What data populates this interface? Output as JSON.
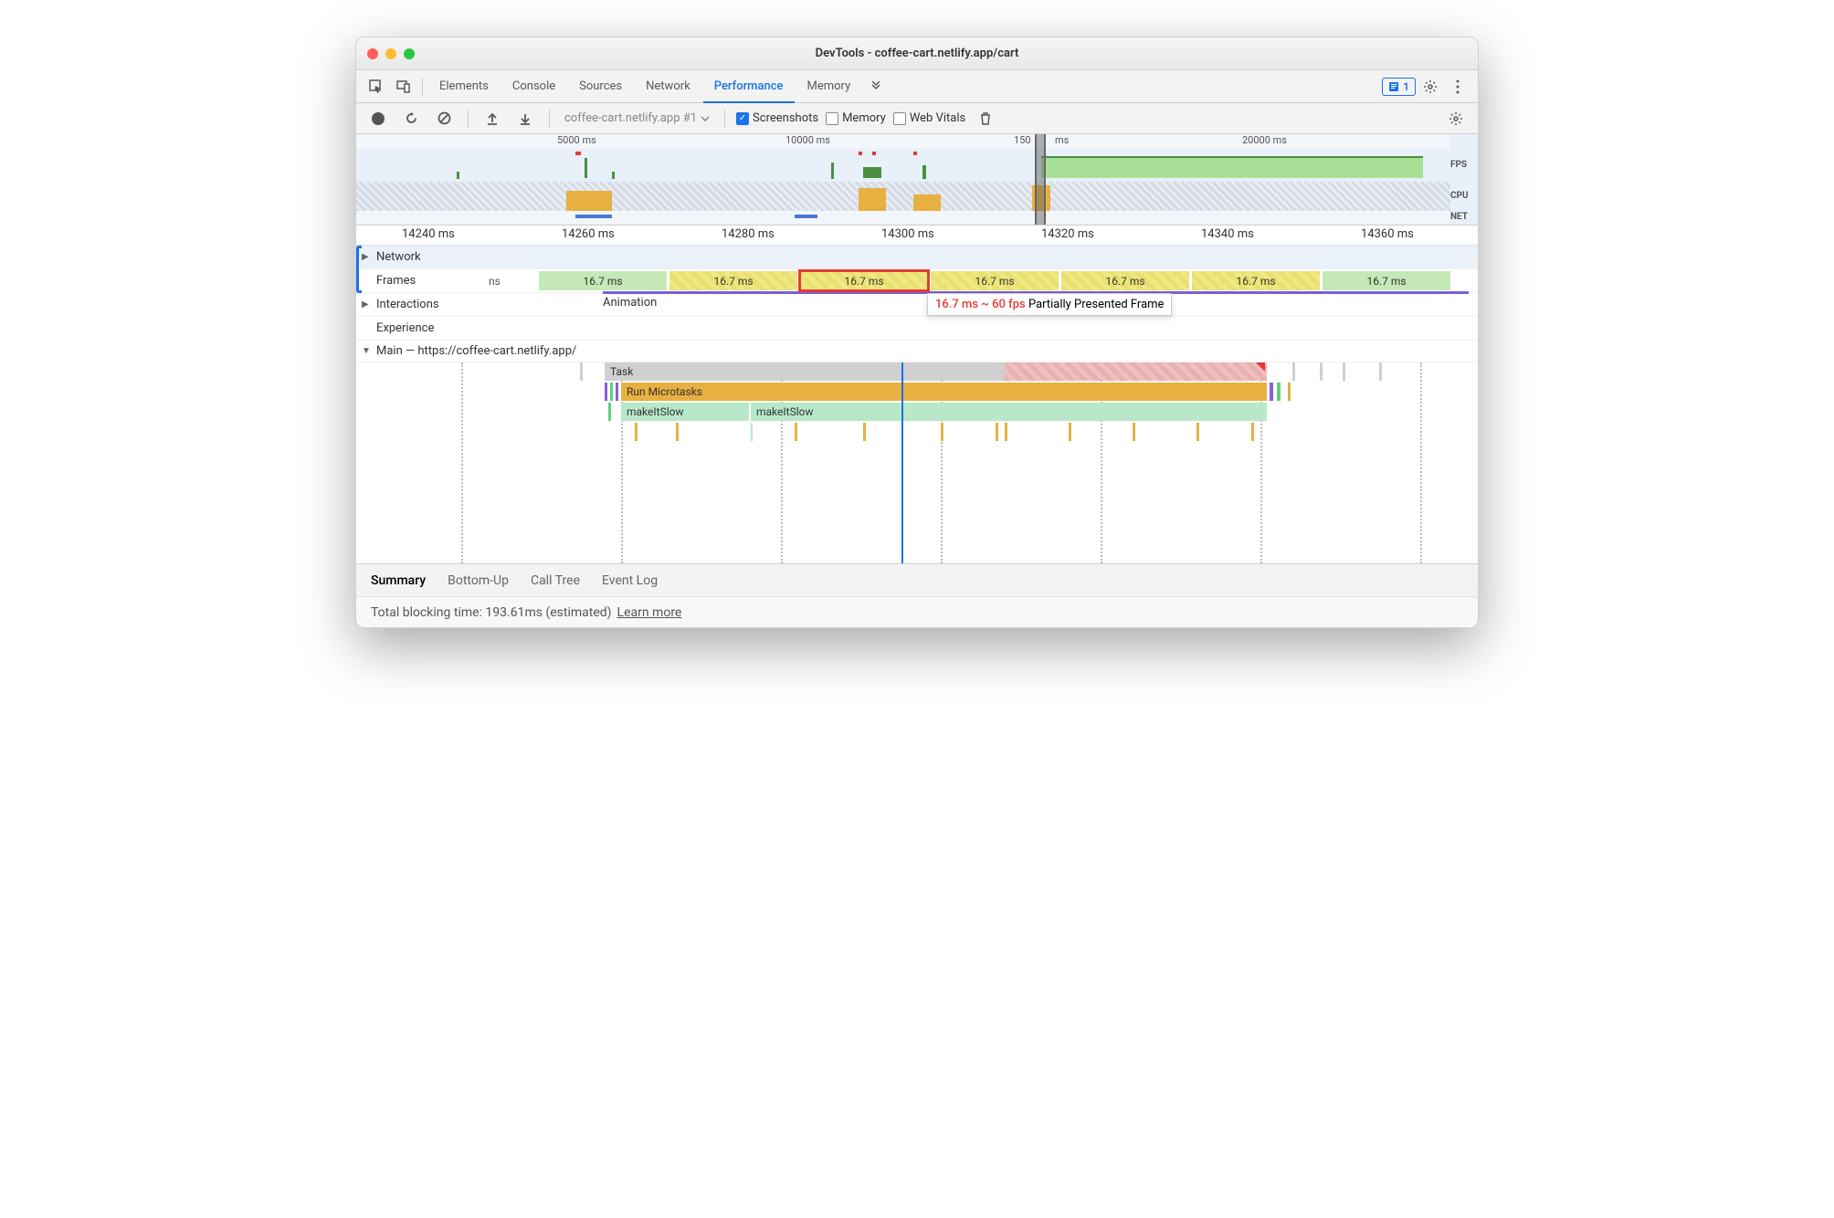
{
  "window": {
    "title": "DevTools - coffee-cart.netlify.app/cart"
  },
  "tabs": {
    "items": [
      "Elements",
      "Console",
      "Sources",
      "Network",
      "Performance",
      "Memory"
    ],
    "active": "Performance",
    "issues_count": "1"
  },
  "toolbar": {
    "recording_label": "coffee-cart.netlify.app #1",
    "screenshots": "Screenshots",
    "memory": "Memory",
    "webvitals": "Web Vitals"
  },
  "overview": {
    "ticks": [
      "5000 ms",
      "10000 ms",
      "150",
      "ms",
      "20000 ms"
    ],
    "labels": {
      "fps": "FPS",
      "cpu": "CPU",
      "net": "NET"
    }
  },
  "ruler": [
    "14240 ms",
    "14260 ms",
    "14280 ms",
    "14300 ms",
    "14320 ms",
    "14340 ms",
    "14360 ms"
  ],
  "tracks": {
    "network": "Network",
    "frames": "Frames",
    "frames_ms": "ns",
    "interactions": "Interactions",
    "animation": "Animation",
    "experience": "Experience",
    "main": "Main — https://coffee-cart.netlify.app/",
    "frame_values": [
      "16.7 ms",
      "16.7 ms",
      "16.7 ms",
      "16.7 ms",
      "16.7 ms",
      "16.7 ms",
      "16.7 ms"
    ]
  },
  "tooltip": {
    "timing": "16.7 ms ~ 60 fps",
    "label": "Partially Presented Frame"
  },
  "flame": {
    "task": "Task",
    "microtasks": "Run Microtasks",
    "slow1": "makeItSlow",
    "slow2": "makeItSlow"
  },
  "bottom_tabs": [
    "Summary",
    "Bottom-Up",
    "Call Tree",
    "Event Log"
  ],
  "status": {
    "text": "Total blocking time: 193.61ms (estimated)",
    "link": "Learn more"
  }
}
